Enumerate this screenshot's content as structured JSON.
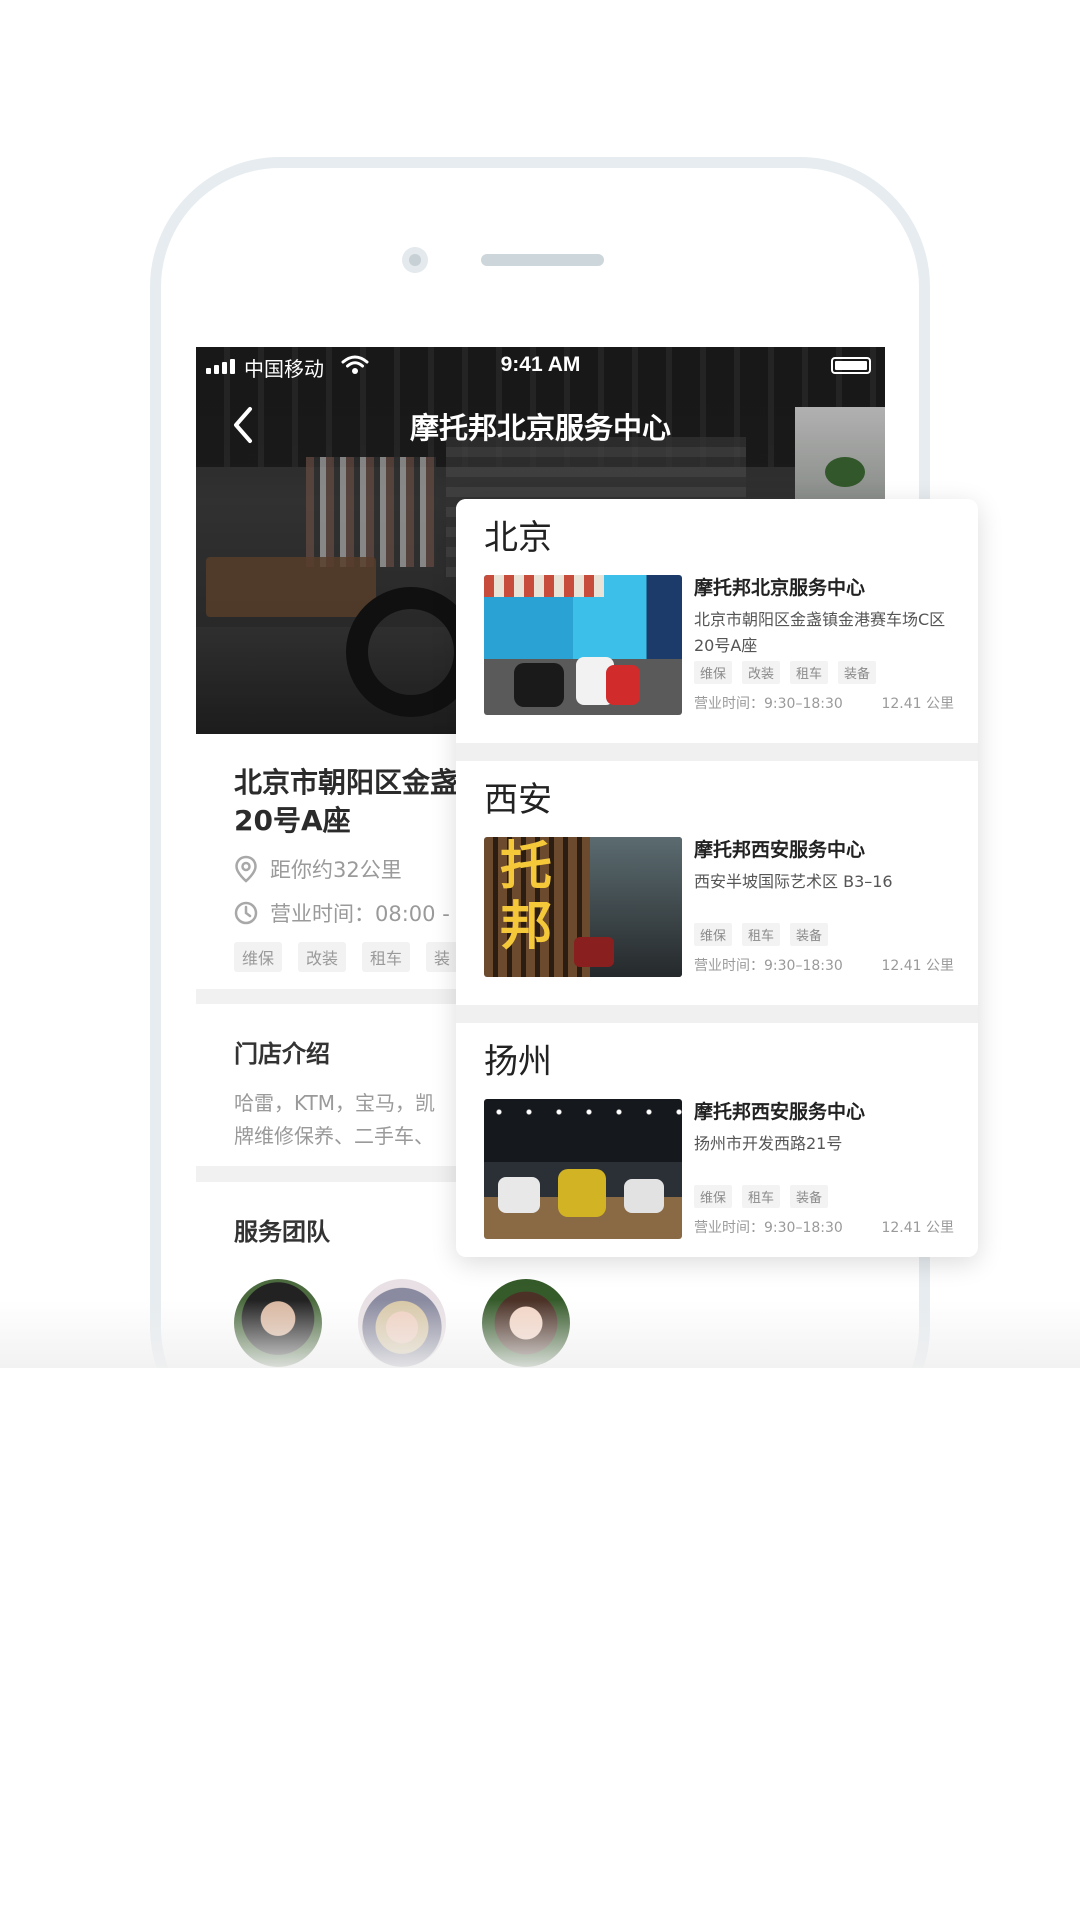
{
  "status_bar": {
    "carrier": "中国移动",
    "time": "9:41 AM"
  },
  "nav": {
    "title": "摩托邦北京服务中心"
  },
  "store_detail": {
    "address": "北京市朝阳区金盏\n20号A座",
    "distance": "距你约32公里",
    "hours": "营业时间：08:00 - 2",
    "tags": [
      "维保",
      "改装",
      "租车",
      "装"
    ]
  },
  "intro": {
    "title": "门店介绍",
    "text": "哈雷，KTM，宝马，凯\n牌维修保养、二手车、"
  },
  "team": {
    "title": "服务团队"
  },
  "cities": [
    {
      "name": "北京",
      "store_name": "摩托邦北京服务中心",
      "address": "北京市朝阳区金盏镇金港赛车场C区20号A座",
      "tags": [
        "维保",
        "改装",
        "租车",
        "装备"
      ],
      "hours": "营业时间：9:30–18:30",
      "distance": "12.41 公里"
    },
    {
      "name": "西安",
      "store_name": "摩托邦西安服务中心",
      "address": "西安半坡国际艺术区 B3–16",
      "tags": [
        "维保",
        "租车",
        "装备"
      ],
      "hours": "营业时间：9:30–18:30",
      "distance": "12.41 公里",
      "photo_text": [
        "托",
        "邦"
      ]
    },
    {
      "name": "扬州",
      "store_name": "摩托邦西安服务中心",
      "address": "扬州市开发西路21号",
      "tags": [
        "维保",
        "租车",
        "装备"
      ],
      "hours": "营业时间：9:30–18:30",
      "distance": "12.41 公里"
    }
  ],
  "icons": {
    "back": "chevron-left-icon",
    "location": "location-pin-icon",
    "clock": "clock-icon",
    "wifi": "wifi-icon",
    "signal": "signal-icon",
    "battery": "battery-icon"
  },
  "colors": {
    "phone_frame": "#e6ecef",
    "tag_bg": "#f2f2f2",
    "text_muted": "#9a9a9a"
  }
}
